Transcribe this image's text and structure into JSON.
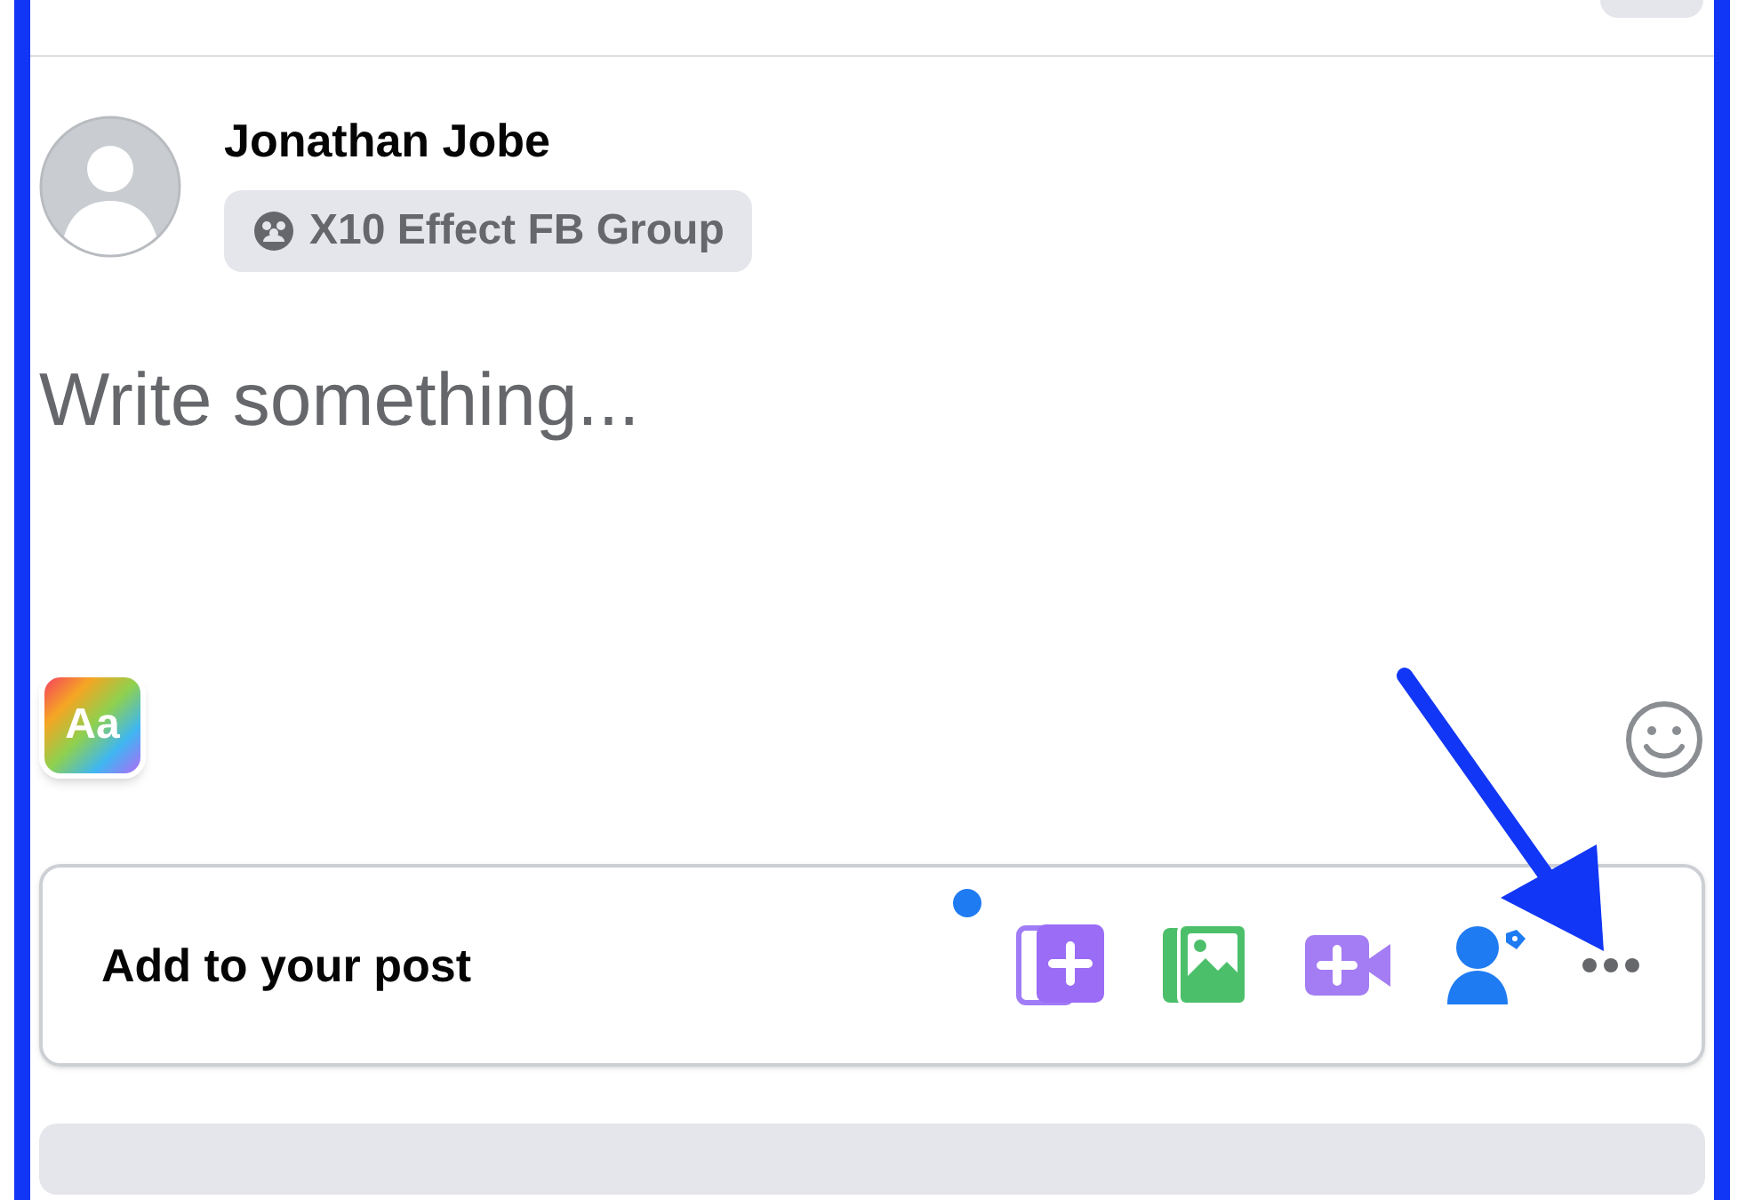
{
  "author": {
    "name": "Jonathan Jobe",
    "audience": "X10 Effect FB Group"
  },
  "composer": {
    "placeholder": "Write something...",
    "text_style_button": "Aa"
  },
  "add_to_post": {
    "label": "Add to your post",
    "tools": [
      {
        "kind": "photo-add"
      },
      {
        "kind": "gallery"
      },
      {
        "kind": "video"
      },
      {
        "kind": "tag"
      },
      {
        "kind": "more"
      }
    ]
  }
}
